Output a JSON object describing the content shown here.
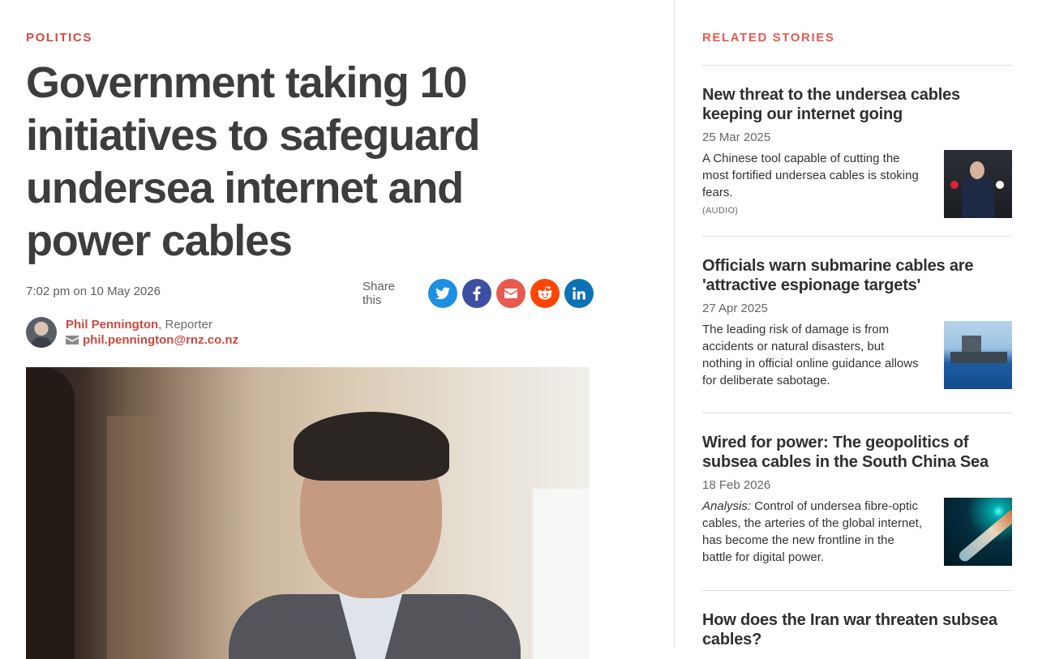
{
  "article": {
    "section": "POLITICS",
    "headline": "Government taking 10 initiatives to safeguard undersea internet and power cables",
    "dateline": "7:02 pm on 10 May 2026",
    "share_label": "Share this",
    "share_buttons": [
      {
        "name": "twitter",
        "icon": "twitter-icon",
        "color": "#1d8fe0"
      },
      {
        "name": "facebook",
        "icon": "facebook-icon",
        "color": "#3c4fa1"
      },
      {
        "name": "email",
        "icon": "envelope-icon",
        "color": "#e8594f"
      },
      {
        "name": "reddit",
        "icon": "reddit-icon",
        "color": "#ff4500"
      },
      {
        "name": "linkedin",
        "icon": "linkedin-icon",
        "color": "#0a72b5"
      }
    ],
    "author": {
      "name": "Phil Pennington",
      "role": ", Reporter",
      "email": "phil.pennington@rnz.co.nz"
    }
  },
  "sidebar": {
    "title": "RELATED STORIES",
    "stories": [
      {
        "title": "New threat to the undersea cables keeping our internet going",
        "date": "25 Mar 2025",
        "summary": "A Chinese tool capable of cutting the most fortified undersea cables is stoking fears.",
        "tag": "(AUDIO)"
      },
      {
        "title": "Officials warn submarine cables are 'attractive espionage targets'",
        "date": "27 Apr 2025",
        "summary": "The leading risk of damage is from accidents or natural disasters, but nothing in official online guidance allows for deliberate sabotage."
      },
      {
        "title": "Wired for power: The geopolitics of subsea cables in the South China Sea",
        "date": "18 Feb 2026",
        "summary_prefix": "Analysis:",
        "summary": " Control of undersea fibre-optic cables, the arteries of the global internet, has become the new frontline in the battle for digital power."
      },
      {
        "title": "How does the Iran war threaten subsea cables?"
      }
    ]
  },
  "colors": {
    "accent_red": "#d14a3f",
    "sidebar_title": "#e35b52",
    "headline": "#3d3d3d"
  }
}
